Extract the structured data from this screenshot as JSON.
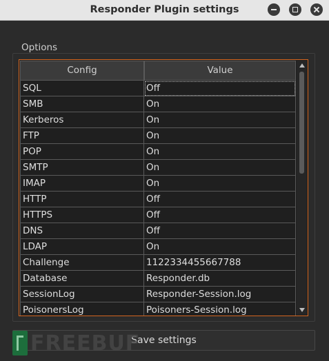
{
  "window": {
    "title": "Responder Plugin settings"
  },
  "options": {
    "group_label": "Options",
    "columns": [
      "Config",
      "Value"
    ],
    "rows": [
      {
        "config": "SQL",
        "value": "Off"
      },
      {
        "config": "SMB",
        "value": "On"
      },
      {
        "config": "Kerberos",
        "value": "On"
      },
      {
        "config": "FTP",
        "value": "On"
      },
      {
        "config": "POP",
        "value": "On"
      },
      {
        "config": "SMTP",
        "value": "On"
      },
      {
        "config": "IMAP",
        "value": "On"
      },
      {
        "config": "HTTP",
        "value": "Off"
      },
      {
        "config": "HTTPS",
        "value": "Off"
      },
      {
        "config": "DNS",
        "value": "Off"
      },
      {
        "config": "LDAP",
        "value": "On"
      },
      {
        "config": "Challenge",
        "value": "1122334455667788"
      },
      {
        "config": "Database",
        "value": "Responder.db"
      },
      {
        "config": "SessionLog",
        "value": "Responder-Session.log"
      },
      {
        "config": "PoisonersLog",
        "value": "Poisoners-Session.log"
      }
    ]
  },
  "footer": {
    "save_label": "Save settings",
    "watermark_text": "FREEBUF"
  },
  "colors": {
    "accent_border": "#d5661f",
    "background": "#2b2b2b"
  }
}
